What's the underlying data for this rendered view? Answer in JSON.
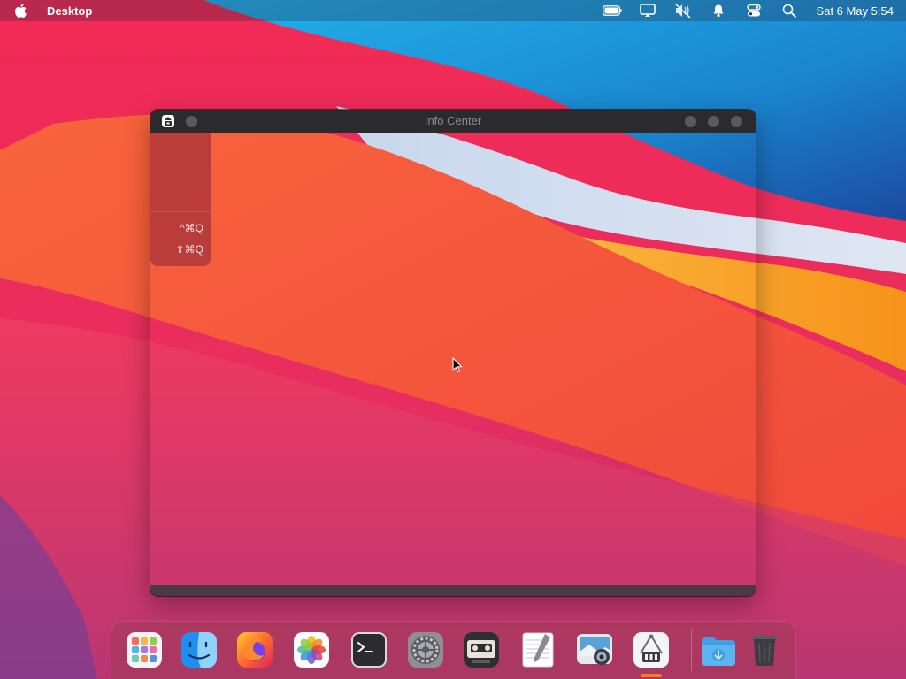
{
  "menubar": {
    "apple_icon": "apple-logo-icon",
    "app_name": "Desktop",
    "status_icons": [
      "battery-icon",
      "display-icon",
      "muted-speaker-icon",
      "notification-bell-icon",
      "control-center-icon",
      "search-icon"
    ],
    "clock": "Sat 6 May 5:54"
  },
  "window": {
    "title": "Info Center",
    "app_icon": "info-center-icon"
  },
  "app_menu": {
    "items": [
      {
        "shortcut": "^⌘Q"
      },
      {
        "shortcut": "⇧⌘Q"
      }
    ]
  },
  "dock": {
    "apps": [
      "launchpad-icon",
      "finder-icon",
      "firefox-icon",
      "photos-icon",
      "terminal-icon",
      "system-preferences-icon",
      "cassette-player-icon",
      "text-editor-icon",
      "screenshot-icon",
      "archive-utility-icon",
      "downloads-folder-icon",
      "trash-icon"
    ],
    "running_indicator_color": "#ff7a1a"
  },
  "colors": {
    "wallpaper_red": "#ea2a55",
    "wallpaper_orange": "#f95a3c",
    "wallpaper_blue": "#1e9ee8",
    "wallpaper_yellow": "#f7a21a"
  }
}
